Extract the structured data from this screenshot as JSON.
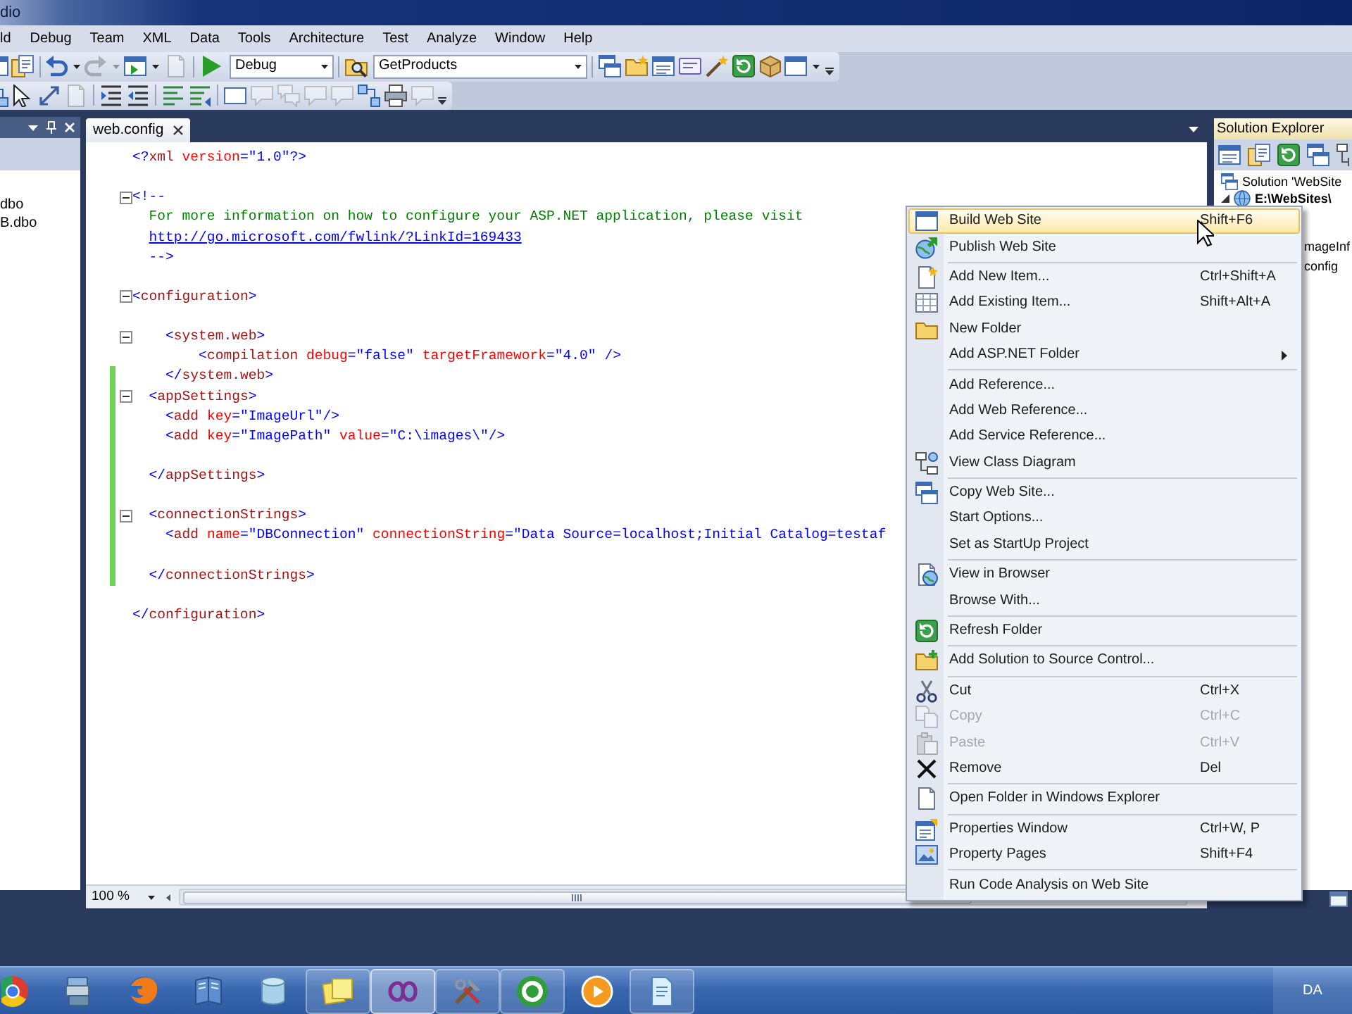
{
  "window": {
    "title": "dio"
  },
  "menu_bar": [
    "ld",
    "Debug",
    "Team",
    "XML",
    "Data",
    "Tools",
    "Architecture",
    "Test",
    "Analyze",
    "Window",
    "Help"
  ],
  "toolbars": [
    {
      "items": [
        {
          "kind": "button",
          "disabled": false
        },
        {
          "kind": "button",
          "disabled": false
        },
        {
          "kind": "separator"
        },
        {
          "kind": "split",
          "disabled": false
        },
        {
          "kind": "split",
          "disabled": true
        },
        {
          "kind": "split",
          "disabled": false
        },
        {
          "kind": "button",
          "disabled": true
        },
        {
          "kind": "separator"
        },
        {
          "kind": "button",
          "disabled": false
        },
        {
          "kind": "combo",
          "value": "Debug"
        },
        {
          "kind": "separator"
        },
        {
          "kind": "button",
          "disabled": false
        },
        {
          "kind": "combo",
          "value": "GetProducts"
        },
        {
          "kind": "separator"
        },
        {
          "kind": "button",
          "disabled": false
        },
        {
          "kind": "button",
          "disabled": false
        },
        {
          "kind": "button",
          "disabled": false
        },
        {
          "kind": "button",
          "disabled": false
        },
        {
          "kind": "button",
          "disabled": false
        },
        {
          "kind": "button",
          "disabled": false
        },
        {
          "kind": "button",
          "disabled": false
        },
        {
          "kind": "split",
          "disabled": false
        },
        {
          "kind": "overflow"
        }
      ]
    },
    {
      "items": [
        {
          "kind": "button",
          "disabled": false
        },
        {
          "kind": "button",
          "disabled": false
        },
        {
          "kind": "button",
          "disabled": false
        },
        {
          "kind": "button",
          "disabled": true
        },
        {
          "kind": "separator"
        },
        {
          "kind": "button",
          "disabled": false
        },
        {
          "kind": "button",
          "disabled": false
        },
        {
          "kind": "separator"
        },
        {
          "kind": "button",
          "disabled": false
        },
        {
          "kind": "button",
          "disabled": false
        },
        {
          "kind": "separator"
        },
        {
          "kind": "button",
          "disabled": false
        },
        {
          "kind": "button",
          "disabled": true
        },
        {
          "kind": "button",
          "disabled": true
        },
        {
          "kind": "button",
          "disabled": true
        },
        {
          "kind": "button",
          "disabled": true
        },
        {
          "kind": "button",
          "disabled": false
        },
        {
          "kind": "button",
          "disabled": false
        },
        {
          "kind": "button",
          "disabled": true
        },
        {
          "kind": "overflow"
        }
      ]
    }
  ],
  "left_panel": {
    "items": [
      "dbo",
      "B.dbo"
    ]
  },
  "editor": {
    "tabs": [
      {
        "label": "web.config",
        "selected": true
      }
    ],
    "lines": [
      {
        "kind": "code",
        "fold": false,
        "changed": false,
        "tokens": [
          {
            "kind": "punct",
            "text": "<?"
          },
          {
            "kind": "tag",
            "text": "xml"
          },
          {
            "kind": "attr",
            "text": " version"
          },
          {
            "kind": "punct",
            "text": "="
          },
          {
            "kind": "value",
            "text": "\"1.0\""
          },
          {
            "kind": "punct",
            "text": "?>"
          }
        ]
      },
      {
        "kind": "blank",
        "changed": false
      },
      {
        "kind": "code",
        "fold": true,
        "changed": false,
        "tokens": [
          {
            "kind": "punct",
            "text": "<!--"
          }
        ]
      },
      {
        "kind": "code",
        "fold": false,
        "changed": false,
        "tokens": [
          {
            "kind": "comment",
            "text": "  For more information on how to configure your ASP.NET application, please visit"
          }
        ]
      },
      {
        "kind": "code",
        "fold": false,
        "changed": false,
        "tokens": [
          {
            "kind": "link",
            "text": "  http://go.microsoft.com/fwlink/?LinkId=169433"
          }
        ]
      },
      {
        "kind": "code",
        "fold": false,
        "changed": false,
        "tokens": [
          {
            "kind": "punct",
            "text": "  -->"
          }
        ]
      },
      {
        "kind": "blank",
        "changed": false
      },
      {
        "kind": "code",
        "fold": true,
        "changed": false,
        "tokens": [
          {
            "kind": "punct",
            "text": "<"
          },
          {
            "kind": "tag",
            "text": "configuration"
          },
          {
            "kind": "punct",
            "text": ">"
          }
        ]
      },
      {
        "kind": "blank",
        "changed": false
      },
      {
        "kind": "code",
        "fold": true,
        "changed": false,
        "tokens": [
          {
            "kind": "punct",
            "text": "    <"
          },
          {
            "kind": "tag",
            "text": "system.web"
          },
          {
            "kind": "punct",
            "text": ">"
          }
        ]
      },
      {
        "kind": "code",
        "fold": false,
        "changed": false,
        "tokens": [
          {
            "kind": "punct",
            "text": "        <"
          },
          {
            "kind": "tag",
            "text": "compilation"
          },
          {
            "kind": "attr",
            "text": " debug"
          },
          {
            "kind": "punct",
            "text": "="
          },
          {
            "kind": "value",
            "text": "\"false\""
          },
          {
            "kind": "attr",
            "text": " targetFramework"
          },
          {
            "kind": "punct",
            "text": "="
          },
          {
            "kind": "value",
            "text": "\"4.0\""
          },
          {
            "kind": "punct",
            "text": " />"
          }
        ]
      },
      {
        "kind": "code",
        "fold": false,
        "changed": true,
        "tokens": [
          {
            "kind": "punct",
            "text": "    </"
          },
          {
            "kind": "tag",
            "text": "system.web"
          },
          {
            "kind": "punct",
            "text": ">"
          }
        ]
      },
      {
        "kind": "code",
        "fold": true,
        "changed": true,
        "tokens": [
          {
            "kind": "punct",
            "text": "  <"
          },
          {
            "kind": "tag",
            "text": "appSettings"
          },
          {
            "kind": "punct",
            "text": ">"
          }
        ]
      },
      {
        "kind": "code",
        "fold": false,
        "changed": true,
        "tokens": [
          {
            "kind": "punct",
            "text": "    <"
          },
          {
            "kind": "tag",
            "text": "add"
          },
          {
            "kind": "attr",
            "text": " key"
          },
          {
            "kind": "punct",
            "text": "="
          },
          {
            "kind": "value",
            "text": "\"ImageUrl\""
          },
          {
            "kind": "punct",
            "text": "/>"
          }
        ]
      },
      {
        "kind": "code",
        "fold": false,
        "changed": true,
        "tokens": [
          {
            "kind": "punct",
            "text": "    <"
          },
          {
            "kind": "tag",
            "text": "add"
          },
          {
            "kind": "attr",
            "text": " key"
          },
          {
            "kind": "punct",
            "text": "="
          },
          {
            "kind": "value",
            "text": "\"ImagePath\""
          },
          {
            "kind": "attr",
            "text": " value"
          },
          {
            "kind": "punct",
            "text": "="
          },
          {
            "kind": "value",
            "text": "\"C:\\images\\\""
          },
          {
            "kind": "punct",
            "text": "/>"
          }
        ]
      },
      {
        "kind": "blank",
        "changed": true
      },
      {
        "kind": "code",
        "fold": false,
        "changed": true,
        "tokens": [
          {
            "kind": "punct",
            "text": "  </"
          },
          {
            "kind": "tag",
            "text": "appSettings"
          },
          {
            "kind": "punct",
            "text": ">"
          }
        ]
      },
      {
        "kind": "blank",
        "changed": true
      },
      {
        "kind": "code",
        "fold": true,
        "changed": true,
        "tokens": [
          {
            "kind": "punct",
            "text": "  <"
          },
          {
            "kind": "tag",
            "text": "connectionStrings"
          },
          {
            "kind": "punct",
            "text": ">"
          }
        ]
      },
      {
        "kind": "code",
        "fold": false,
        "changed": true,
        "tokens": [
          {
            "kind": "punct",
            "text": "    <"
          },
          {
            "kind": "tag",
            "text": "add"
          },
          {
            "kind": "attr",
            "text": " name"
          },
          {
            "kind": "punct",
            "text": "="
          },
          {
            "kind": "value",
            "text": "\"DBConnection\""
          },
          {
            "kind": "attr",
            "text": " connectionString"
          },
          {
            "kind": "punct",
            "text": "="
          },
          {
            "kind": "value",
            "text": "\"Data Source=localhost;Initial Catalog=testaf"
          }
        ]
      },
      {
        "kind": "blank",
        "changed": true
      },
      {
        "kind": "code",
        "fold": false,
        "changed": true,
        "tokens": [
          {
            "kind": "punct",
            "text": "  </"
          },
          {
            "kind": "tag",
            "text": "connectionStrings"
          },
          {
            "kind": "punct",
            "text": ">"
          }
        ]
      },
      {
        "kind": "blank",
        "changed": false
      },
      {
        "kind": "code",
        "fold": false,
        "changed": false,
        "tokens": [
          {
            "kind": "punct",
            "text": "</"
          },
          {
            "kind": "tag",
            "text": "configuration"
          },
          {
            "kind": "punct",
            "text": ">"
          }
        ]
      }
    ],
    "zoom": "100 %"
  },
  "solution_explorer": {
    "title": "Solution Explorer",
    "tree": [
      {
        "label": "Solution 'WebSite",
        "bold": false,
        "children": [
          {
            "label": "E:\\WebSites\\",
            "bold": true,
            "expanded": true,
            "children": [
              {
                "label": "mageInf",
                "bold": false
              },
              {
                "label": "config",
                "bold": false
              }
            ]
          }
        ]
      }
    ]
  },
  "context_menu": {
    "sections": [
      {
        "items": [
          {
            "label": "Build Web Site",
            "shortcut": "Shift+F6",
            "selected": true,
            "disabled": false,
            "submenu": false
          },
          {
            "label": "Publish Web Site",
            "selected": false,
            "disabled": false,
            "submenu": false
          }
        ]
      },
      {
        "items": [
          {
            "label": "Add New Item...",
            "shortcut": "Ctrl+Shift+A",
            "selected": false,
            "disabled": false,
            "submenu": false
          },
          {
            "label": "Add Existing Item...",
            "shortcut": "Shift+Alt+A",
            "selected": false,
            "disabled": false,
            "submenu": false
          },
          {
            "label": "New Folder",
            "selected": false,
            "disabled": false,
            "submenu": false
          },
          {
            "label": "Add ASP.NET Folder",
            "selected": false,
            "disabled": false,
            "submenu": true
          }
        ]
      },
      {
        "items": [
          {
            "label": "Add Reference...",
            "selected": false,
            "disabled": false,
            "submenu": false
          },
          {
            "label": "Add Web Reference...",
            "selected": false,
            "disabled": false,
            "submenu": false
          },
          {
            "label": "Add Service Reference...",
            "selected": false,
            "disabled": false,
            "submenu": false
          },
          {
            "label": "View Class Diagram",
            "selected": false,
            "disabled": false,
            "submenu": false
          }
        ]
      },
      {
        "items": [
          {
            "label": "Copy Web Site...",
            "selected": false,
            "disabled": false,
            "submenu": false
          },
          {
            "label": "Start Options...",
            "selected": false,
            "disabled": false,
            "submenu": false
          },
          {
            "label": "Set as StartUp Project",
            "selected": false,
            "disabled": false,
            "submenu": false
          }
        ]
      },
      {
        "items": [
          {
            "label": "View in Browser",
            "selected": false,
            "disabled": false,
            "submenu": false
          },
          {
            "label": "Browse With...",
            "selected": false,
            "disabled": false,
            "submenu": false
          }
        ]
      },
      {
        "items": [
          {
            "label": "Refresh Folder",
            "selected": false,
            "disabled": false,
            "submenu": false
          }
        ]
      },
      {
        "items": [
          {
            "label": "Add Solution to Source Control...",
            "selected": false,
            "disabled": false,
            "submenu": false
          }
        ]
      },
      {
        "items": [
          {
            "label": "Cut",
            "shortcut": "Ctrl+X",
            "selected": false,
            "disabled": false,
            "submenu": false
          },
          {
            "label": "Copy",
            "shortcut": "Ctrl+C",
            "selected": false,
            "disabled": true,
            "submenu": false
          },
          {
            "label": "Paste",
            "shortcut": "Ctrl+V",
            "selected": false,
            "disabled": true,
            "submenu": false
          },
          {
            "label": "Remove",
            "shortcut": "Del",
            "selected": false,
            "disabled": false,
            "submenu": false
          }
        ]
      },
      {
        "items": [
          {
            "label": "Open Folder in Windows Explorer",
            "selected": false,
            "disabled": false,
            "submenu": false
          }
        ]
      },
      {
        "items": [
          {
            "label": "Properties Window",
            "shortcut": "Ctrl+W, P",
            "selected": false,
            "disabled": false,
            "submenu": false
          },
          {
            "label": "Property Pages",
            "shortcut": "Shift+F4",
            "selected": false,
            "disabled": false,
            "submenu": false
          }
        ]
      },
      {
        "items": [
          {
            "label": "Run Code Analysis on Web Site",
            "selected": false,
            "disabled": false,
            "submenu": false
          }
        ]
      }
    ]
  },
  "taskbar": {
    "buttons": [
      {
        "running": false,
        "active": false
      },
      {
        "running": false,
        "active": false
      },
      {
        "running": false,
        "active": false
      },
      {
        "running": false,
        "active": false
      },
      {
        "running": false,
        "active": false
      },
      {
        "running": true,
        "active": false
      },
      {
        "running": true,
        "active": true
      },
      {
        "running": true,
        "active": false
      },
      {
        "running": true,
        "active": false
      },
      {
        "running": false,
        "active": false
      },
      {
        "running": true,
        "active": false
      }
    ],
    "language": "DA"
  }
}
